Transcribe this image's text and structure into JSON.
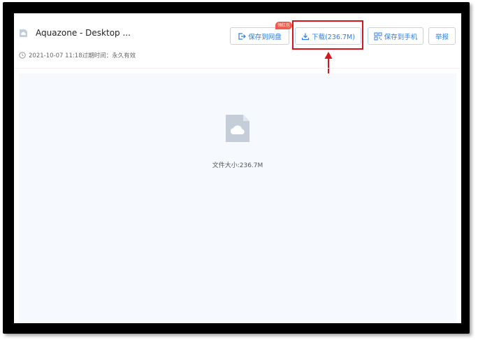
{
  "file": {
    "title": "Aquazone - Desktop ...",
    "meta_text": "2021-10-07 11:18过期时间：永久有效",
    "size_text": "文件大小:236.7M"
  },
  "actions": {
    "save_to_cloud": "保存到网盘",
    "download": "下载(236.7M)",
    "save_to_phone": "保存到手机",
    "report": "举报",
    "badge": "领红包"
  },
  "icons": {
    "file_small": "cloud-file-icon",
    "clock": "clock-icon",
    "save": "save-to-cloud-icon",
    "download": "download-icon",
    "phone": "qr-phone-icon",
    "file_large": "cloud-file-icon"
  },
  "colors": {
    "accent": "#2c7ee8",
    "button_border": "#b9d6f3",
    "highlight": "#d9131b",
    "badge": "#f45a4a",
    "preview_bg": "#f6f9fd",
    "file_icon": "#c5ced8"
  }
}
